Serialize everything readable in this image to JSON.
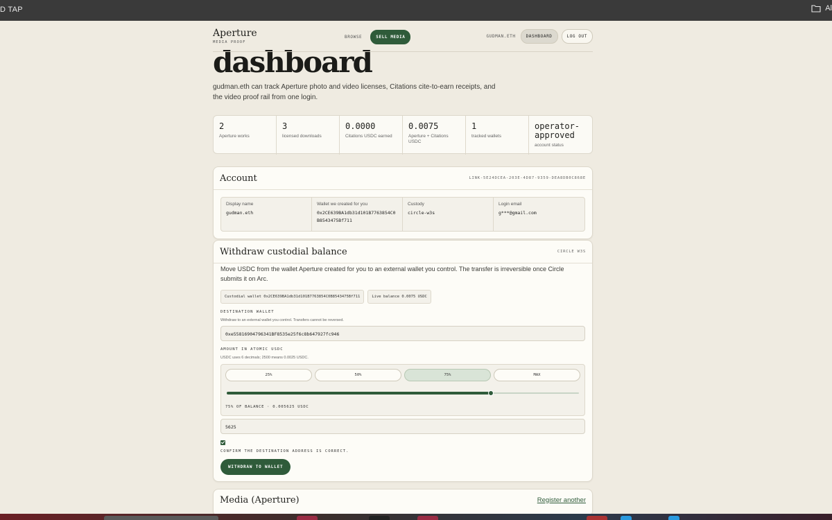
{
  "os": {
    "left_label": "D TAP",
    "right_label": "Al",
    "right_icon": "folder-icon"
  },
  "header": {
    "brand": "Aperture",
    "brand_sub": "MEDIA PROOF",
    "nav_browse": "BROWSE",
    "nav_sell": "SELL MEDIA",
    "user": "GUDMAN.ETH",
    "dashboard": "DASHBOARD",
    "logout": "LOG OUT"
  },
  "page": {
    "title": "dashboard",
    "intro": "gudman.eth can track Aperture photo and video licenses, Citations cite-to-earn receipts, and the video proof rail from one login."
  },
  "stats": [
    {
      "value": "2",
      "label": "Aperture works"
    },
    {
      "value": "3",
      "label": "licensed downloads"
    },
    {
      "value": "0.0000",
      "label": "Citations USDC earned"
    },
    {
      "value": "0.0075",
      "label": "Aperture + Citations USDC"
    },
    {
      "value": "1",
      "label": "tracked wallets"
    },
    {
      "value": "operator-approved",
      "label": "account status"
    }
  ],
  "account": {
    "title": "Account",
    "link_id": "LINK-5E24DCEA-203E-4D87-9359-DEA8DB0C868E",
    "fields": [
      {
        "label": "Display name",
        "value": "gudman.eth"
      },
      {
        "label": "Wallet we created for you",
        "value": "0x2CE639BA1db31d101B7763854C0B8543475Bf711"
      },
      {
        "label": "Custody",
        "value": "circle-w3s"
      },
      {
        "label": "Login email",
        "value": "g***@gmail.com"
      }
    ]
  },
  "withdraw": {
    "title": "Withdraw custodial balance",
    "tag": "CIRCLE W3S",
    "description": "Move USDC from the wallet Aperture created for you to an external wallet you control. The transfer is irreversible once Circle submits it on Arc.",
    "chip_wallet": "Custodial wallet 0x2CE639BA1db31d101B7763854C0B8543475Bf711",
    "chip_balance": "Live balance 0.0075 USDC",
    "dest_label": "DESTINATION WALLET",
    "dest_help": "Withdraw to an external wallet you control. Transfers cannot be reversed.",
    "dest_value": "0xe55816904796341BF8535e25f6c8b647927fc946",
    "amount_label": "AMOUNT IN ATOMIC USDC",
    "amount_help": "USDC uses 6 decimals; 2500 means 0.0025 USDC.",
    "pct_options": [
      "25%",
      "50%",
      "75%",
      "MAX"
    ],
    "pct_active": "75%",
    "slider_fraction": 0.75,
    "pct_caption": "75% OF BALANCE · 0.005625 USDC",
    "amount_value": "5625",
    "confirm_label": "CONFIRM THE DESTINATION ADDRESS IS CORRECT.",
    "button": "WITHDRAW TO WALLET",
    "accent": "#2f5b3a"
  },
  "media": {
    "title": "Media (Aperture)",
    "link": "Register another"
  }
}
